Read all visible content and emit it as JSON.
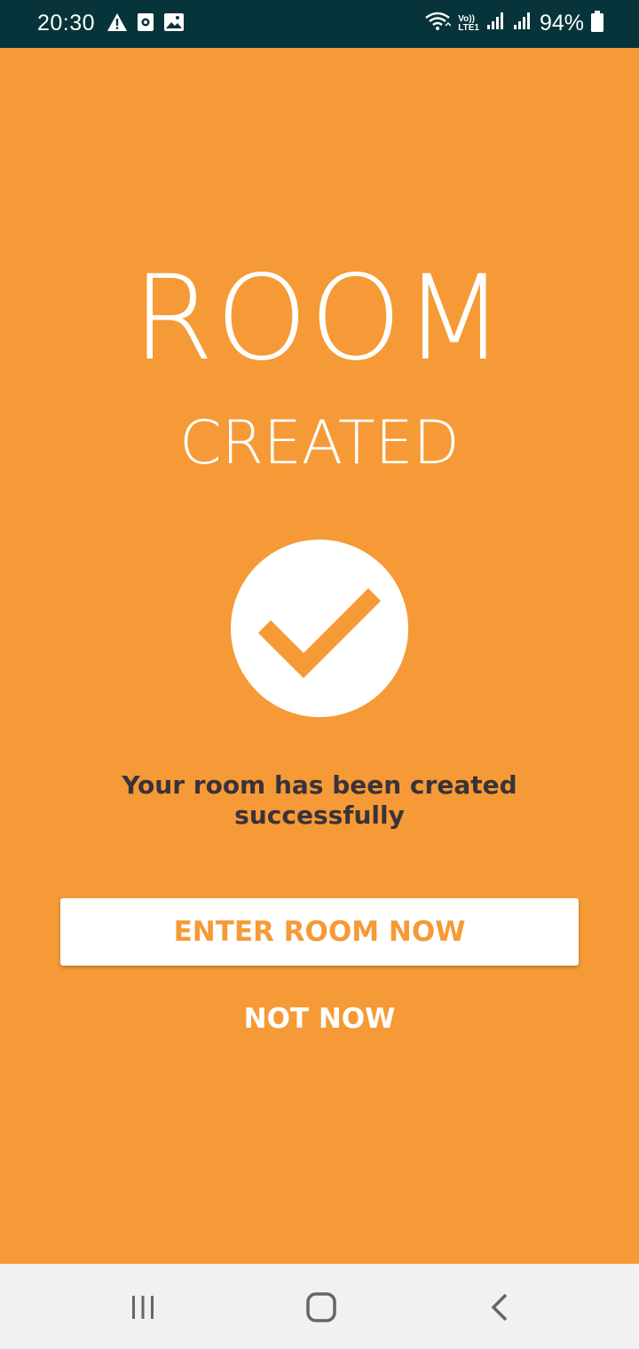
{
  "status_bar": {
    "time": "20:30",
    "battery": "94%",
    "icons_left": [
      "warning-icon",
      "screen-recorder-icon",
      "image-icon"
    ],
    "icons_right": [
      "wifi-icon",
      "volte-icon",
      "signal-icon",
      "signal-icon-2",
      "battery-icon"
    ],
    "volte_label_top": "Vo))",
    "volte_label_bottom": "LTE1"
  },
  "main": {
    "title_line1": "ROOM",
    "title_line2": "CREATED",
    "check_icon": "check-circle-icon",
    "message": "Your room has been created successfully",
    "enter_button": "ENTER ROOM NOW",
    "not_now": "NOT NOW"
  },
  "nav_bar": {
    "items": [
      "recent-apps-icon",
      "home-icon",
      "back-icon"
    ]
  },
  "colors": {
    "background": "#f59a36",
    "status_bar": "#06343a",
    "message_text": "#3a3238",
    "nav_bar": "#f1f1f1"
  }
}
